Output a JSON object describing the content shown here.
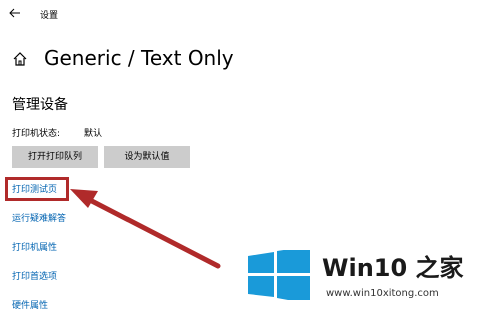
{
  "window": {
    "title": "设置"
  },
  "header": {
    "page_title": "Generic / Text Only"
  },
  "section": {
    "title": "管理设备"
  },
  "status": {
    "label": "打印机状态:",
    "value": "默认"
  },
  "buttons": {
    "open_queue": "打开打印队列",
    "set_default": "设为默认值"
  },
  "links": [
    "打印测试页",
    "运行疑难解答",
    "打印机属性",
    "打印首选项",
    "硬件属性"
  ],
  "watermark": {
    "brand": "Win10 之家",
    "url": "www.win10xitong.com"
  },
  "colors": {
    "link": "#0063b1",
    "button_bg": "#cccccc",
    "highlight": "#b02a2a",
    "windows_blue": "#1a9ad9"
  },
  "icons": {
    "back": "back-arrow-icon",
    "home": "home-icon",
    "logo": "windows-logo-icon"
  }
}
